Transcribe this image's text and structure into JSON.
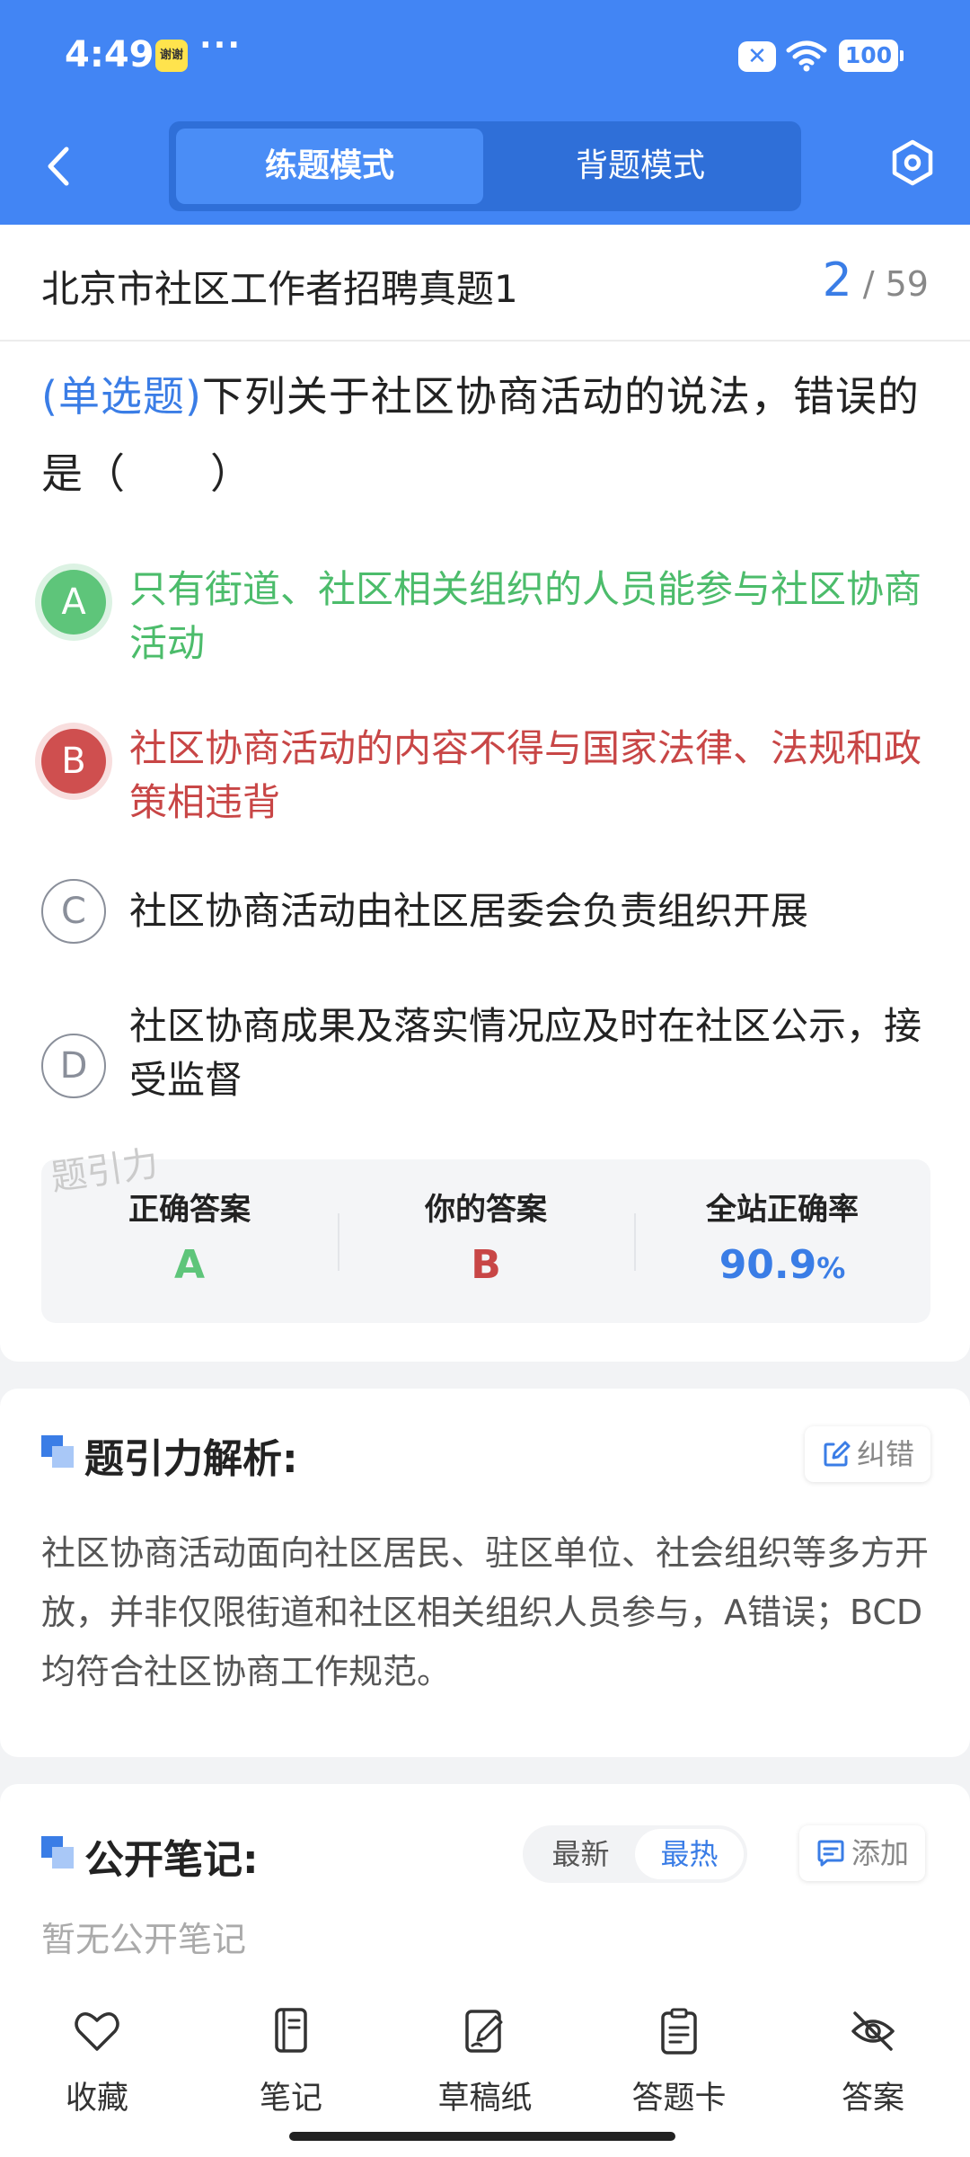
{
  "status_bar": {
    "time": "4:49",
    "app_badge": "谢谢",
    "more": "···",
    "dnd": "✕",
    "battery": "100"
  },
  "header": {
    "mode_active": "练题模式",
    "mode_inactive": "背题模式"
  },
  "question": {
    "paper_title": "北京市社区工作者招聘真题1",
    "current": "2",
    "total": "/ 59",
    "type": "(单选题)",
    "stem": "下列关于社区协商活动的说法，错误的是（　　）",
    "options": [
      {
        "letter": "A",
        "text": "只有街道、社区相关组织的人员能参与社区协商活动",
        "state": "correct"
      },
      {
        "letter": "B",
        "text": "社区协商活动的内容不得与国家法律、法规和政策相违背",
        "state": "wrong"
      },
      {
        "letter": "C",
        "text": "社区协商活动由社区居委会负责组织开展",
        "state": "normal"
      },
      {
        "letter": "D",
        "text": "社区协商成果及落实情况应及时在社区公示，接受监督",
        "state": "normal"
      }
    ],
    "watermark": "题引力"
  },
  "stats": {
    "correct_label": "正确答案",
    "correct_value": "A",
    "yours_label": "你的答案",
    "yours_value": "B",
    "rate_label": "全站正确率",
    "rate_value": "90.9",
    "rate_unit": "%"
  },
  "analysis": {
    "title": "题引力解析:",
    "report_label": "纠错",
    "body": "社区协商活动面向社区居民、驻区单位、社会组织等多方开放，并非仅限街道和社区相关组织人员参与，A错误；BCD均符合社区协商工作规范。"
  },
  "notes": {
    "title": "公开笔记:",
    "sort_newest": "最新",
    "sort_hottest": "最热",
    "add_label": "添加",
    "empty_text": "暂无公开笔记"
  },
  "toolbar": {
    "items": [
      {
        "label": "收藏",
        "icon": "heart-icon"
      },
      {
        "label": "笔记",
        "icon": "notebook-icon"
      },
      {
        "label": "草稿纸",
        "icon": "draft-pen-icon"
      },
      {
        "label": "答题卡",
        "icon": "clipboard-icon"
      },
      {
        "label": "答案",
        "icon": "eye-off-icon"
      }
    ]
  },
  "colors": {
    "primary": "#4285f4",
    "correct": "#5ec57a",
    "wrong": "#c84646",
    "accent_text": "#3a7de6"
  }
}
